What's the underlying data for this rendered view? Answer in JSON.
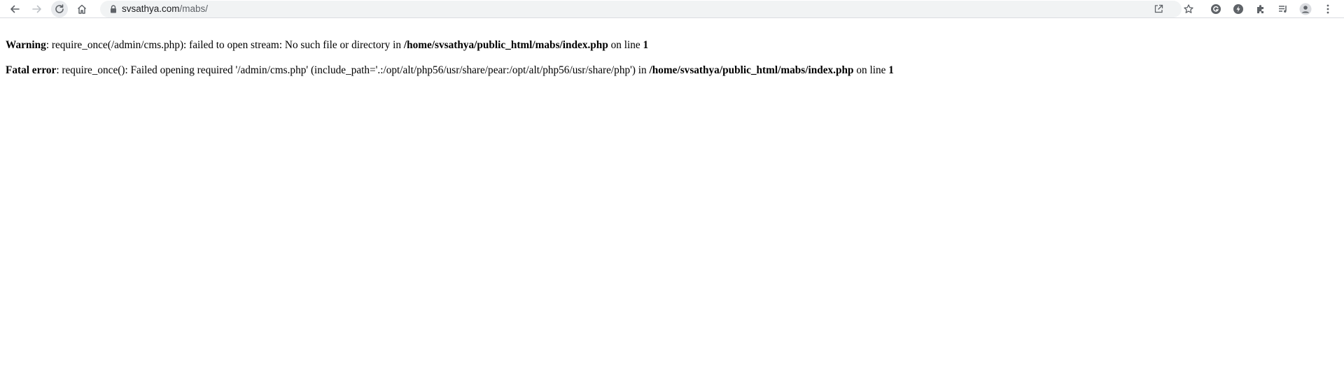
{
  "browser": {
    "url_host": "svsathya.com",
    "url_path": "/mabs/",
    "nav": {
      "back_icon": "arrow-left-icon",
      "forward_icon": "arrow-right-icon",
      "reload_icon": "reload-icon",
      "home_icon": "home-icon"
    },
    "toolbar_icons": [
      "share-icon",
      "bookmark-star-icon",
      "grammarly-icon",
      "lightning-extension-icon",
      "extensions-puzzle-icon",
      "reading-list-icon",
      "profile-avatar-icon",
      "kebab-menu-icon"
    ]
  },
  "page": {
    "warning": {
      "label": "Warning",
      "message": ": require_once(/admin/cms.php): failed to open stream: No such file or directory in ",
      "file": "/home/svsathya/public_html/mabs/index.php",
      "line_text": " on line ",
      "line": "1"
    },
    "fatal": {
      "label": "Fatal error",
      "message": ": require_once(): Failed opening required '/admin/cms.php' (include_path='.:/opt/alt/php56/usr/share/pear:/opt/alt/php56/usr/share/php') in ",
      "file": "/home/svsathya/public_html/mabs/index.php",
      "line_text": " on line ",
      "line": "1"
    }
  }
}
